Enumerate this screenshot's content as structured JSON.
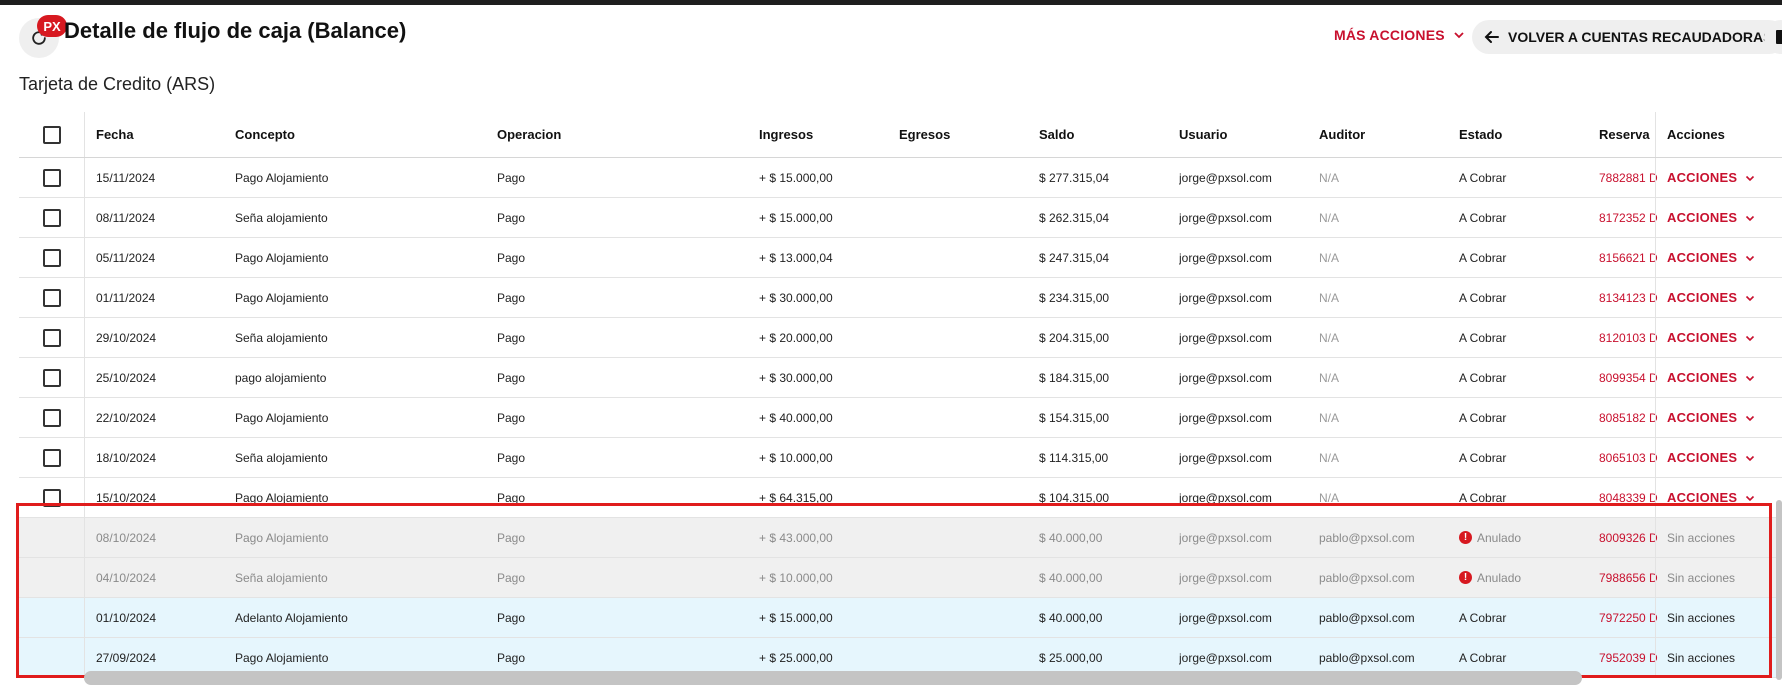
{
  "header": {
    "title": "Detalle de flujo de caja (Balance)",
    "badge": "PX",
    "more_actions": "MÁS ACCIONES",
    "back_button": "VOLVER A CUENTAS RECAUDADORAS"
  },
  "subtitle": "Tarjeta de Credito (ARS)",
  "table": {
    "columns": {
      "fecha": "Fecha",
      "concepto": "Concepto",
      "operacion": "Operacion",
      "ingresos": "Ingresos",
      "egresos": "Egresos",
      "saldo": "Saldo",
      "usuario": "Usuario",
      "auditor": "Auditor",
      "estado": "Estado",
      "reserva": "Reserva",
      "acciones": "Acciones"
    },
    "rows": [
      {
        "fecha": "15/11/2024",
        "concepto": "Pago Alojamiento",
        "operacion": "Pago",
        "ingresos": "+ $ 15.000,00",
        "egresos": "",
        "saldo": "$ 277.315,04",
        "usuario": "jorge@pxsol.com",
        "auditor": "N/A",
        "estado": "A Cobrar",
        "reserva": "7882881 D",
        "acciones": "ACCIONES"
      },
      {
        "fecha": "08/11/2024",
        "concepto": "Seña alojamiento",
        "operacion": "Pago",
        "ingresos": "+ $ 15.000,00",
        "egresos": "",
        "saldo": "$ 262.315,04",
        "usuario": "jorge@pxsol.com",
        "auditor": "N/A",
        "estado": "A Cobrar",
        "reserva": "8172352 D",
        "acciones": "ACCIONES"
      },
      {
        "fecha": "05/11/2024",
        "concepto": "Pago Alojamiento",
        "operacion": "Pago",
        "ingresos": "+ $ 13.000,04",
        "egresos": "",
        "saldo": "$ 247.315,04",
        "usuario": "jorge@pxsol.com",
        "auditor": "N/A",
        "estado": "A Cobrar",
        "reserva": "8156621 D",
        "acciones": "ACCIONES"
      },
      {
        "fecha": "01/11/2024",
        "concepto": "Pago Alojamiento",
        "operacion": "Pago",
        "ingresos": "+ $ 30.000,00",
        "egresos": "",
        "saldo": "$ 234.315,00",
        "usuario": "jorge@pxsol.com",
        "auditor": "N/A",
        "estado": "A Cobrar",
        "reserva": "8134123 D",
        "acciones": "ACCIONES"
      },
      {
        "fecha": "29/10/2024",
        "concepto": "Seña alojamiento",
        "operacion": "Pago",
        "ingresos": "+ $ 20.000,00",
        "egresos": "",
        "saldo": "$ 204.315,00",
        "usuario": "jorge@pxsol.com",
        "auditor": "N/A",
        "estado": "A Cobrar",
        "reserva": "8120103 D",
        "acciones": "ACCIONES"
      },
      {
        "fecha": "25/10/2024",
        "concepto": "pago alojamiento",
        "operacion": "Pago",
        "ingresos": "+ $ 30.000,00",
        "egresos": "",
        "saldo": "$ 184.315,00",
        "usuario": "jorge@pxsol.com",
        "auditor": "N/A",
        "estado": "A Cobrar",
        "reserva": "8099354 D",
        "acciones": "ACCIONES"
      },
      {
        "fecha": "22/10/2024",
        "concepto": "Pago Alojamiento",
        "operacion": "Pago",
        "ingresos": "+ $ 40.000,00",
        "egresos": "",
        "saldo": "$ 154.315,00",
        "usuario": "jorge@pxsol.com",
        "auditor": "N/A",
        "estado": "A Cobrar",
        "reserva": "8085182 D",
        "acciones": "ACCIONES"
      },
      {
        "fecha": "18/10/2024",
        "concepto": "Seña alojamiento",
        "operacion": "Pago",
        "ingresos": "+ $ 10.000,00",
        "egresos": "",
        "saldo": "$ 114.315,00",
        "usuario": "jorge@pxsol.com",
        "auditor": "N/A",
        "estado": "A Cobrar",
        "reserva": "8065103 D",
        "acciones": "ACCIONES"
      },
      {
        "fecha": "15/10/2024",
        "concepto": "Pago Alojamiento",
        "operacion": "Pago",
        "ingresos": "+ $ 64.315,00",
        "egresos": "",
        "saldo": "$ 104.315,00",
        "usuario": "jorge@pxsol.com",
        "auditor": "N/A",
        "estado": "A Cobrar",
        "reserva": "8048339 D",
        "acciones": "ACCIONES"
      },
      {
        "fecha": "08/10/2024",
        "concepto": "Pago Alojamiento",
        "operacion": "Pago",
        "ingresos": "+ $ 43.000,00",
        "egresos": "",
        "saldo": "$ 40.000,00",
        "usuario": "jorge@pxsol.com",
        "auditor": "pablo@pxsol.com",
        "estado": "Anulado",
        "reserva": "8009326 D",
        "acciones": "Sin acciones"
      },
      {
        "fecha": "04/10/2024",
        "concepto": "Seña alojamiento",
        "operacion": "Pago",
        "ingresos": "+ $ 10.000,00",
        "egresos": "",
        "saldo": "$ 40.000,00",
        "usuario": "jorge@pxsol.com",
        "auditor": "pablo@pxsol.com",
        "estado": "Anulado",
        "reserva": "7988656 D",
        "acciones": "Sin acciones"
      },
      {
        "fecha": "01/10/2024",
        "concepto": "Adelanto Alojamiento",
        "operacion": "Pago",
        "ingresos": "+ $ 15.000,00",
        "egresos": "",
        "saldo": "$ 40.000,00",
        "usuario": "jorge@pxsol.com",
        "auditor": "pablo@pxsol.com",
        "estado": "A Cobrar",
        "reserva": "7972250 D",
        "acciones": "Sin acciones"
      },
      {
        "fecha": "27/09/2024",
        "concepto": "Pago Alojamiento",
        "operacion": "Pago",
        "ingresos": "+ $ 25.000,00",
        "egresos": "",
        "saldo": "$ 25.000,00",
        "usuario": "jorge@pxsol.com",
        "auditor": "pablo@pxsol.com",
        "estado": "A Cobrar",
        "reserva": "7952039 D",
        "acciones": "Sin acciones"
      }
    ]
  },
  "colors": {
    "accent": "#c8102e",
    "annulled_row": "#f0f0f0",
    "highlight_row": "#e6f6fd",
    "selection_outline": "#e01c1c"
  },
  "icons": {
    "refresh": "refresh-icon",
    "back": "arrow-left-icon",
    "chevron": "chevron-down-icon",
    "warning": "warning-icon",
    "book": "book-icon"
  }
}
